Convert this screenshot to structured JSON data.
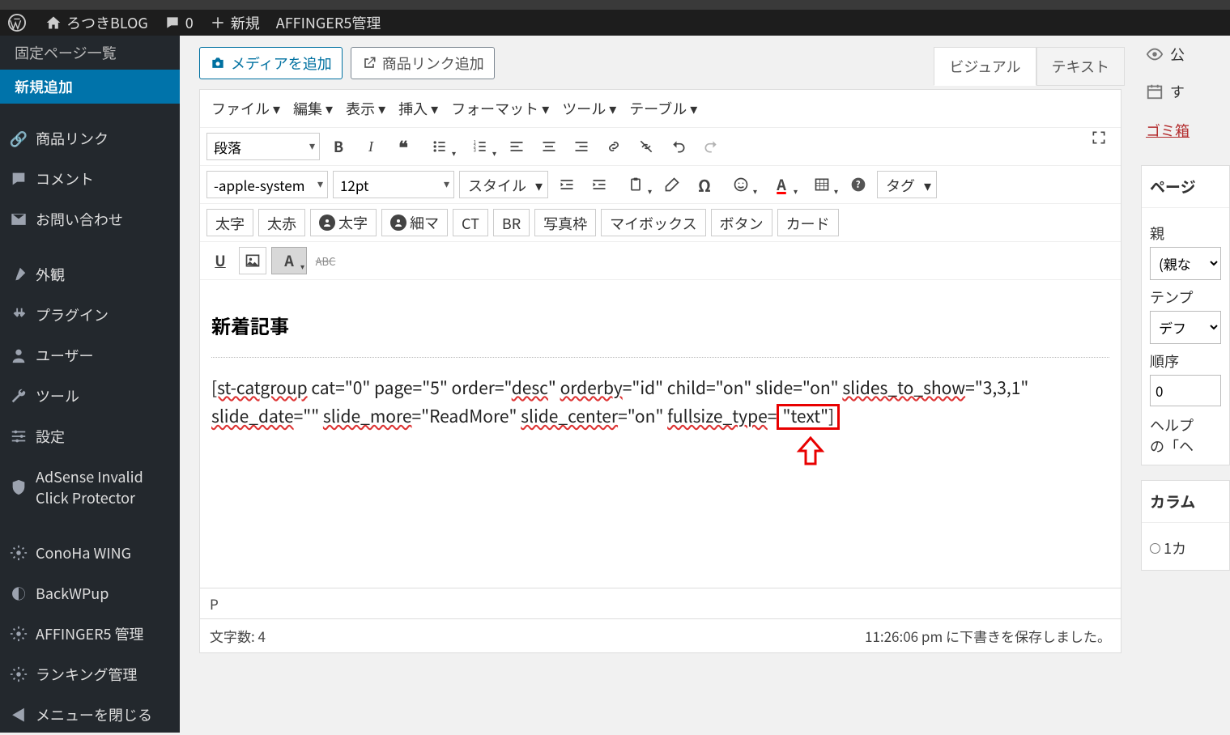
{
  "topbar": {
    "site_name": "ろつきBLOG",
    "comments": "0",
    "new_label": "新規",
    "affinger": "AFFINGER5管理"
  },
  "sidebar": {
    "page_list": "固定ページ一覧",
    "add_new": "新規追加",
    "items": [
      "商品リンク",
      "コメント",
      "お問い合わせ",
      "外観",
      "プラグイン",
      "ユーザー",
      "ツール",
      "設定",
      "AdSense Invalid Click Protector",
      "ConoHa WING",
      "BackWPup",
      "AFFINGER5 管理",
      "ランキング管理",
      "メニューを閉じる"
    ]
  },
  "buttons": {
    "add_media": "メディアを追加",
    "add_productlink": "商品リンク追加"
  },
  "tabs": {
    "visual": "ビジュアル",
    "text": "テキスト"
  },
  "menubar": [
    "ファイル",
    "編集",
    "表示",
    "挿入",
    "フォーマット",
    "ツール",
    "テーブル"
  ],
  "toolbar": {
    "paragraph": "段落",
    "font": "-apple-system",
    "size": "12pt",
    "style": "スタイル",
    "tag": "タグ",
    "futoji": "太字",
    "futoaka": "太赤",
    "maru_futoji": "太字",
    "maru_hosoma": "細マ",
    "ct": "CT",
    "br": "BR",
    "frame": "写真枠",
    "mybox": "マイボックス",
    "button": "ボタン",
    "card": "カード"
  },
  "content": {
    "heading": "新着記事",
    "p1a": "[st-catgroup",
    "p1b": " cat=\"0\" page=\"5\" order=\"",
    "p1c": "desc",
    "p1d": "\" ",
    "p1e": "orderby",
    "p1f": "=\"id\" child=\"on\" slide=\"on\" ",
    "p1g": "slides_to_show",
    "p1h": "=\"3,3,1\" ",
    "p2a": "slide_date",
    "p2b": "=\"\" ",
    "p2c": "slide_more",
    "p2d": "=\"ReadMore\" ",
    "p2e": "slide_center",
    "p2f": "=\"on\" ",
    "p2g": "fullsize_type",
    "p2h": "=",
    "p2i": "\"text\"]"
  },
  "status": {
    "path": "P",
    "wordcount_label": "文字数:",
    "wordcount": "4",
    "autosave_time": "11:26:06 pm",
    "autosave_msg": "に下書きを保存しました。"
  },
  "right": {
    "publish": "公",
    "schedule": "す",
    "trash": "ゴミ箱",
    "panel_title": "ページ",
    "parent_label": "親",
    "parent_value": "(親な",
    "template_label": "テンプ",
    "template_value": "デフ",
    "order_label": "順序",
    "order_value": "0",
    "help1": "ヘルプ",
    "help2": "の「ヘ",
    "panel2_title": "カラム",
    "col_option": "1カ"
  }
}
